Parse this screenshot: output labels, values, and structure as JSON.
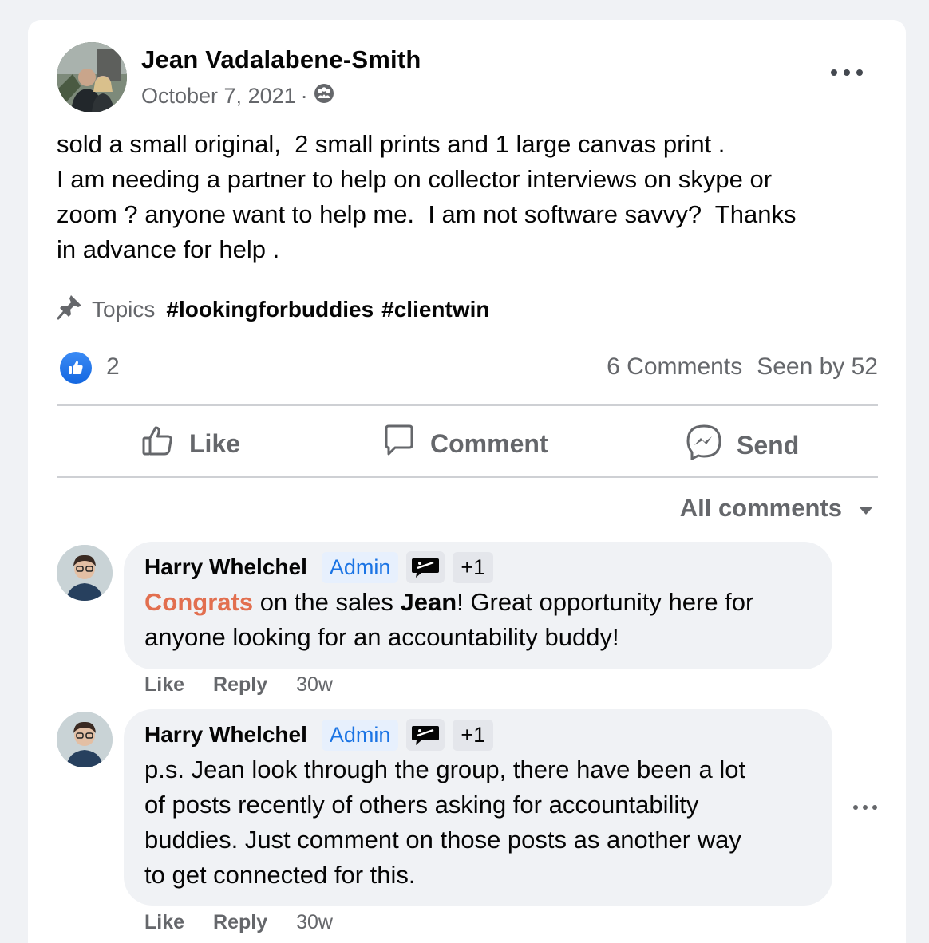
{
  "post": {
    "author": "Jean Vadalabene-Smith",
    "date": "October 7, 2021",
    "separator": "·",
    "privacy_icon": "group-icon",
    "lines": [
      "sold a small original,  2 small prints and 1 large canvas print .",
      "I am needing a partner to help on collector interviews on skype or",
      "zoom ? anyone want to help me.  I am not software savvy?  Thanks",
      "in advance for help ."
    ],
    "topics_label": "Topics",
    "tags": [
      "#lookingforbuddies",
      "#clientwin"
    ],
    "reaction_count": "2",
    "comments_count": "6 Comments",
    "seen_by": "Seen by 52"
  },
  "actions": {
    "like": "Like",
    "comment": "Comment",
    "send": "Send"
  },
  "sort_label": "All comments",
  "comments": [
    {
      "name": "Harry Whelchel",
      "badge": "Admin",
      "plus": "+1",
      "highlight": "Congrats",
      "part1": " on the sales ",
      "bold": "Jean",
      "part2": "! Great opportunity here for",
      "line2": "anyone looking for an accountability buddy!",
      "like": "Like",
      "reply": "Reply",
      "time": "30w"
    },
    {
      "name": "Harry Whelchel",
      "badge": "Admin",
      "plus": "+1",
      "lines": [
        "p.s. Jean look through the group, there have been a lot",
        "of posts recently of others asking for accountability",
        "buddies. Just comment on those posts as another way",
        "to get connected for this."
      ],
      "like": "Like",
      "reply": "Reply",
      "time": "30w"
    }
  ],
  "colors": {
    "page_bg": "#f0f2f5",
    "accent_blue": "#1b74e4",
    "congrats_orange": "#e26f4f",
    "secondary_text": "#65676b"
  }
}
